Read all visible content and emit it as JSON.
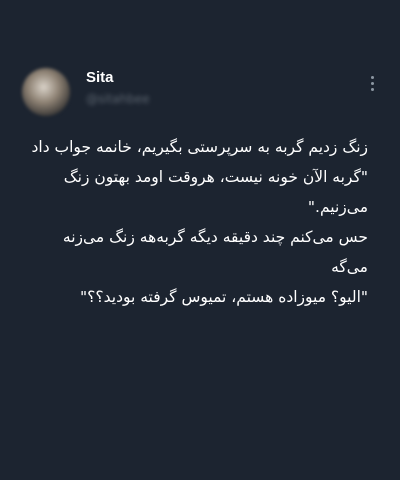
{
  "tweet": {
    "author": {
      "display_name": "Sita",
      "handle": "@sitahbee"
    },
    "paragraphs": [
      "زنگ زدیم گربه به سرپرستی بگیریم، خانمه جواب داد \"گربه الآن خونه نیست، هروقت اومد بهتون زنگ می‌زنیم.\"",
      "حس می‌کنم چند دقیقه دیگه گربه‌هه زنگ می‌زنه می‌گه",
      "\"الیو؟ میوزاده هستم، تمیوس گرفته بودید؟؟\""
    ]
  },
  "icons": {
    "more": "more-vertical-icon"
  },
  "colors": {
    "background": "#1c2430",
    "text": "#ffffff",
    "muted": "#6e7781"
  }
}
